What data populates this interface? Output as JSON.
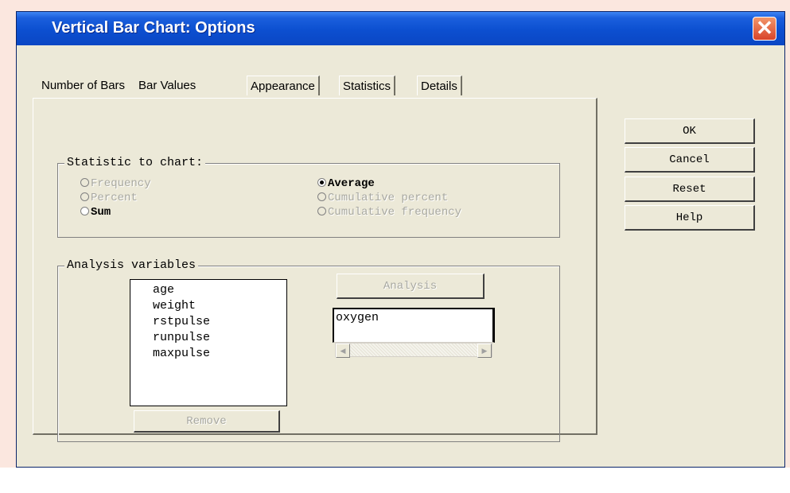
{
  "window": {
    "title": "Vertical Bar Chart: Options"
  },
  "icons": {
    "close": "close-icon"
  },
  "tabs": [
    {
      "label": "Number of Bars"
    },
    {
      "label": "Bar Values"
    },
    {
      "label": "Appearance"
    },
    {
      "label": "Statistics"
    },
    {
      "label": "Details"
    }
  ],
  "statistic_group": {
    "title": "Statistic to chart:",
    "options": [
      {
        "label": "Frequency",
        "enabled": false,
        "checked": false
      },
      {
        "label": "Percent",
        "enabled": false,
        "checked": false
      },
      {
        "label": "Sum",
        "enabled": true,
        "checked": false
      },
      {
        "label": "Average",
        "enabled": true,
        "checked": true
      },
      {
        "label": "Cumulative percent",
        "enabled": false,
        "checked": false
      },
      {
        "label": "Cumulative frequency",
        "enabled": false,
        "checked": false
      }
    ]
  },
  "analysis_group": {
    "title": "Analysis variables",
    "available_variables": [
      "age",
      "weight",
      "rstpulse",
      "runpulse",
      "maxpulse"
    ],
    "remove_button": "Remove",
    "analysis_button": "Analysis",
    "selected_variable": "oxygen"
  },
  "buttons": {
    "ok": "OK",
    "cancel": "Cancel",
    "reset": "Reset",
    "help": "Help"
  }
}
